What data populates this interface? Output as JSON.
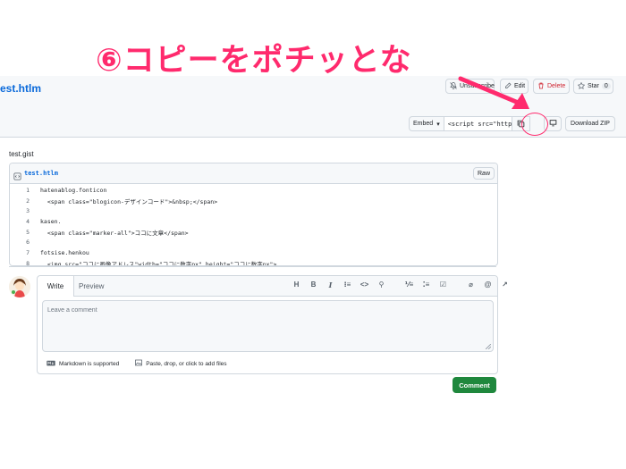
{
  "annotation": {
    "text": "⑥コピーをポチッとな"
  },
  "header": {
    "gist_title": "est.htlm",
    "unsubscribe_label": "Unsubscribe",
    "edit_label": "Edit",
    "delete_label": "Delete",
    "star_label": "Star",
    "star_count": "0",
    "embed_label": "Embed",
    "embed_value": "<script src=\"https://",
    "download_label": "Download ZIP"
  },
  "gist": {
    "description": "test.gist",
    "filename": "test.htlm",
    "raw_label": "Raw",
    "lines": [
      {
        "n": "1",
        "code": "hatenablog.fonticon"
      },
      {
        "n": "2",
        "code": "  <span class=\"blogicon-デザインコード\">&nbsp;</span>"
      },
      {
        "n": "3",
        "code": ""
      },
      {
        "n": "4",
        "code": "kasen."
      },
      {
        "n": "5",
        "code": "  <span class=\"marker-all\">ココに文章</span>"
      },
      {
        "n": "6",
        "code": ""
      },
      {
        "n": "7",
        "code": "fotsise.henkou"
      },
      {
        "n": "8",
        "code": "  <img src=\"ココに画像アドレス\"width=\"ココに数字px\" height=\"ココに数字px\">"
      }
    ]
  },
  "comment": {
    "tab_write": "Write",
    "tab_preview": "Preview",
    "placeholder": "Leave a comment",
    "markdown_label": "Markdown is supported",
    "attach_label": "Paste, drop, or click to add files",
    "submit_label": "Comment"
  },
  "colors": {
    "accent": "#0969da",
    "annotation": "#ff2a6d",
    "submit": "#1f883d",
    "danger": "#cf222e"
  }
}
